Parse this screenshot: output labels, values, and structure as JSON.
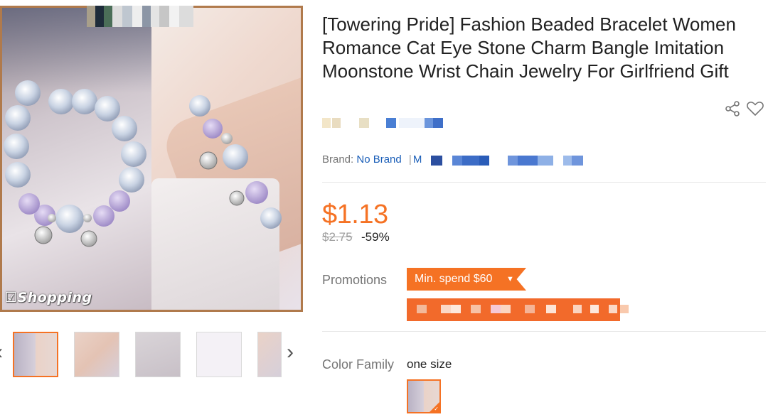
{
  "product": {
    "title": "[Towering Pride] Fashion Beaded Bracelet Women Romance Cat Eye Stone Charm Bangle Imitation Moonstone Wrist Chain Jewelry For Girlfriend Gift",
    "image_watermark": "Shopping"
  },
  "icons": {
    "share": "share-icon",
    "wishlist": "heart-icon",
    "prev": "chevron-left-icon",
    "next": "chevron-right-icon"
  },
  "brand": {
    "label": "Brand:",
    "value": "No Brand",
    "separator": "|",
    "more_prefix": "M"
  },
  "price": {
    "current": "$1.13",
    "original": "$2.75",
    "discount": "-59%"
  },
  "promotions": {
    "label": "Promotions",
    "tag": "Min. spend $60",
    "tag_caret": "▼"
  },
  "color_family": {
    "label": "Color Family",
    "value": "one size"
  },
  "colors": {
    "accent": "#f57224",
    "link": "#1a5eb8",
    "frame": "#b07a4c"
  }
}
